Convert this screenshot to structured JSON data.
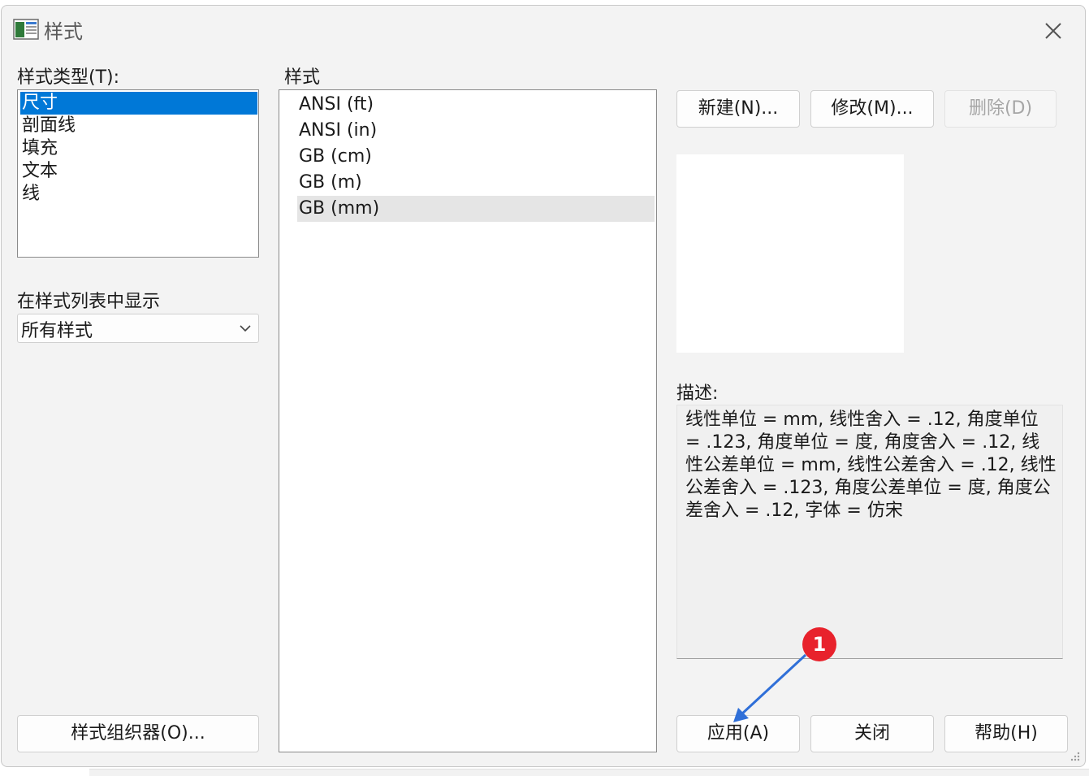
{
  "window": {
    "title": "样式",
    "app_icon": "app-icon",
    "close_icon": "close-icon"
  },
  "left": {
    "type_label": "样式类型(T):",
    "types": [
      "尺寸",
      "剖面线",
      "填充",
      "文本",
      "线"
    ],
    "selected_type": "尺寸",
    "show_label": "在样式列表中显示",
    "show_value": "所有样式",
    "organizer_button": "样式组织器(O)..."
  },
  "middle": {
    "label": "样式",
    "styles": [
      "ANSI (ft)",
      "ANSI (in)",
      "GB (cm)",
      "GB (m)",
      "GB (mm)"
    ],
    "highlighted": "GB (mm)"
  },
  "right": {
    "new_button": "新建(N)...",
    "modify_button": "修改(M)...",
    "delete_button": "删除(D)",
    "desc_label": "描述:",
    "description": "线性单位 = mm, 线性舍入 = .12, 角度单位 = .123, 角度单位 = 度, 角度舍入 = .12, 线性公差单位 = mm, 线性公差舍入 = .12, 线性公差舍入 = .123, 角度公差单位 = 度, 角度公差舍入 = .12, 字体 = 仿宋"
  },
  "footer": {
    "apply_button": "应用(A)",
    "close_button": "关闭",
    "help_button": "帮助(H)"
  },
  "annotation": {
    "marker_number": "1",
    "marker_color": "#e8222c",
    "arrow_color": "#2f6fd8"
  },
  "colors": {
    "selection": "#0078d7",
    "window_bg": "#f3f3f3"
  }
}
